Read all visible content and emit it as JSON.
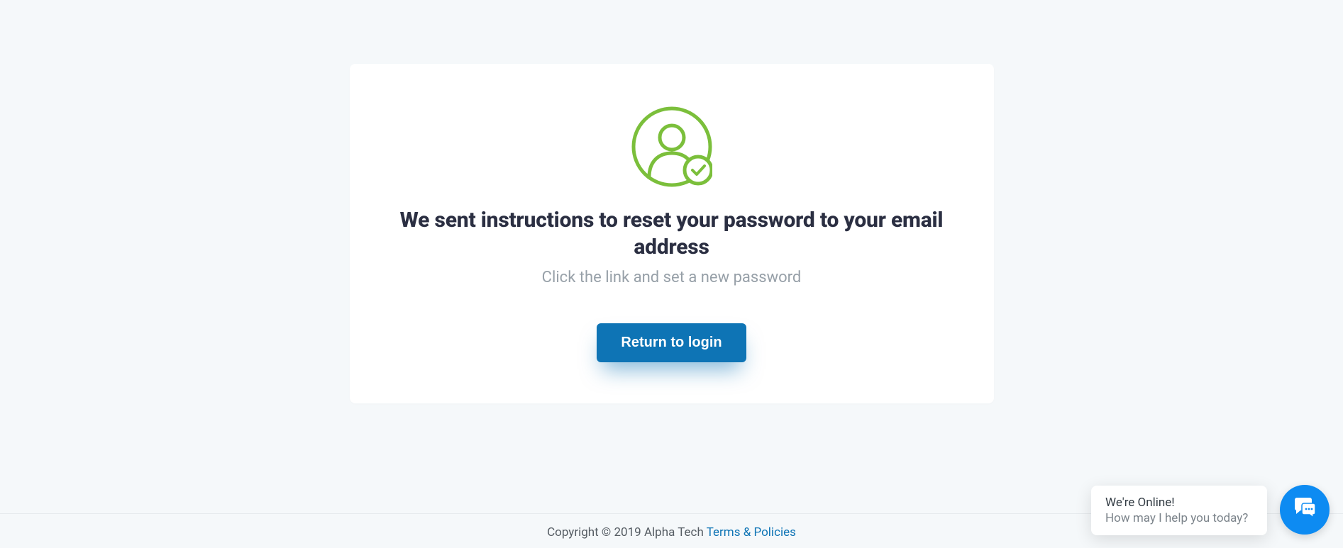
{
  "card": {
    "heading": "We sent instructions to reset your password to your email address",
    "subtext": "Click the link and set a new password",
    "button_label": "Return to login"
  },
  "footer": {
    "copyright": "Copyright © 2019 Alpha Tech ",
    "link_label": "Terms & Policies"
  },
  "chat": {
    "title": "We're Online!",
    "subtitle": "How may I help you today?"
  },
  "colors": {
    "accent_green": "#7bbf3b",
    "primary_blue": "#0e74b5",
    "chat_blue": "#0d8bf2"
  }
}
